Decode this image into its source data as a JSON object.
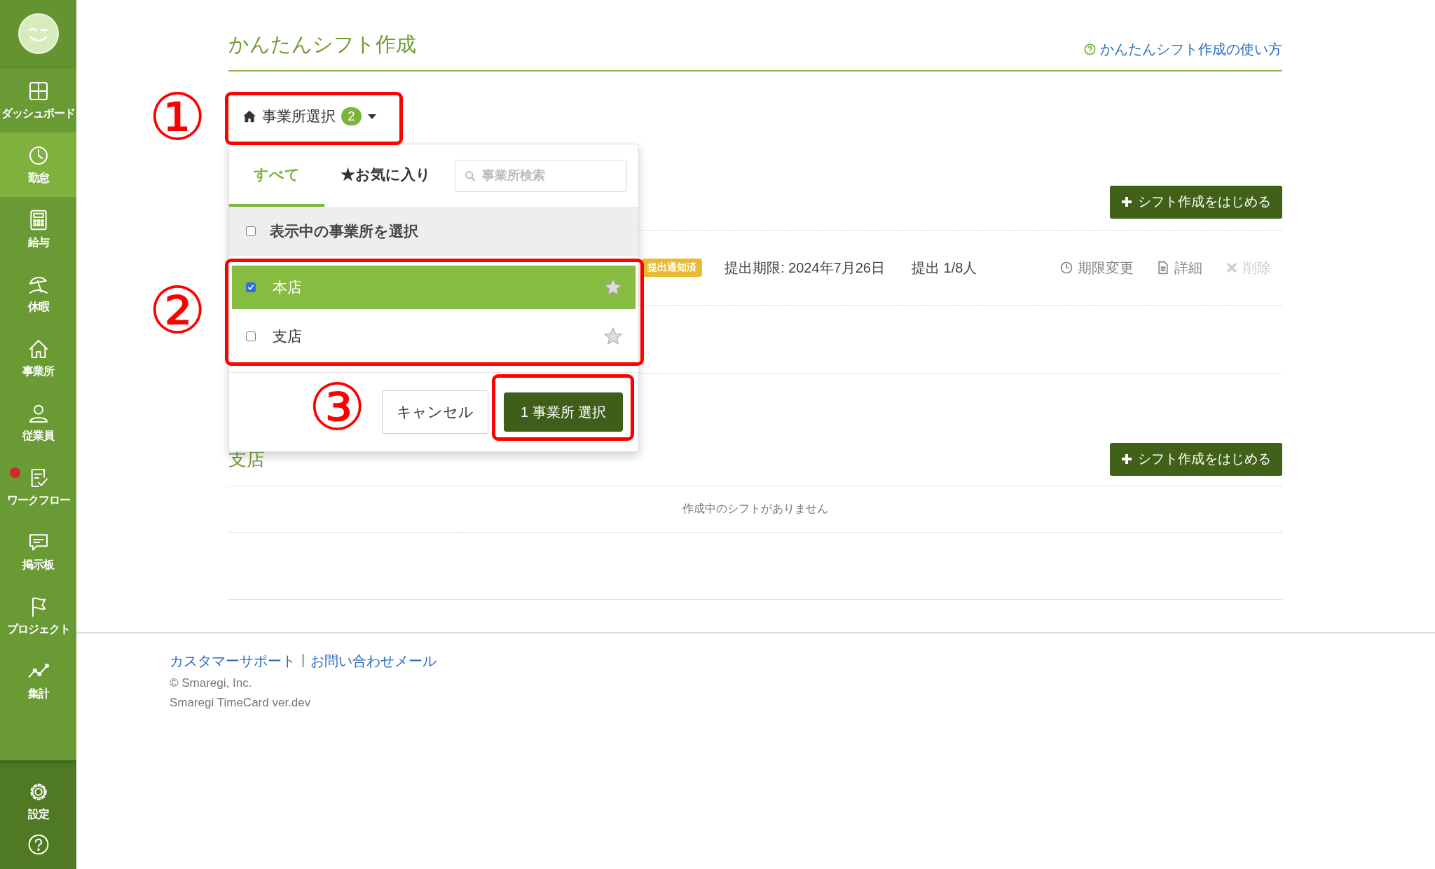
{
  "sidebar": {
    "items": [
      {
        "label": "ダッシュボード",
        "selected": false,
        "alert": false
      },
      {
        "label": "勤怠",
        "selected": true,
        "alert": false
      },
      {
        "label": "給与",
        "selected": false,
        "alert": false
      },
      {
        "label": "休暇",
        "selected": false,
        "alert": false
      },
      {
        "label": "事業所",
        "selected": false,
        "alert": false
      },
      {
        "label": "従業員",
        "selected": false,
        "alert": false
      },
      {
        "label": "ワークフロー",
        "selected": false,
        "alert": true
      },
      {
        "label": "掲示板",
        "selected": false,
        "alert": false
      },
      {
        "label": "プロジェクト",
        "selected": false,
        "alert": false
      },
      {
        "label": "集計",
        "selected": false,
        "alert": false
      }
    ],
    "bottom_items": [
      {
        "label": "設定"
      }
    ]
  },
  "page": {
    "title": "かんたんシフト作成",
    "help_link": "かんたんシフト作成の使い方"
  },
  "office_picker": {
    "label": "事業所選択",
    "count": "2",
    "expanded": true
  },
  "dropdown": {
    "tabs": [
      {
        "label": "すべて",
        "selected": true
      },
      {
        "label": "★お気に入り",
        "selected": false
      }
    ],
    "search": {
      "placeholder": "事業所検索"
    },
    "select_all": {
      "label": "表示中の事業所を選択",
      "checked": false
    },
    "offices": [
      {
        "name": "本店",
        "checked": true,
        "favorite": false
      },
      {
        "name": "支店",
        "checked": false,
        "favorite": false
      }
    ],
    "cancel_button": "キャンセル",
    "confirm_button": "1 事業所 選択"
  },
  "sections": [
    {
      "start_button": "シフト作成をはじめる",
      "shifts": [
        {
          "status": "提出通知済",
          "deadline": "提出期限: 2024年7月26日",
          "submitted": "提出 1/8人",
          "actions": [
            {
              "label": "期限変更",
              "kind": "deadline",
              "disabled": false
            },
            {
              "label": "詳細",
              "kind": "detail",
              "disabled": false
            },
            {
              "label": "削除",
              "kind": "delete",
              "disabled": true
            }
          ]
        }
      ]
    },
    {
      "name": "支店",
      "start_button": "シフト作成をはじめる",
      "empty_text": "作成中のシフトがありません"
    }
  ],
  "footer": {
    "links": [
      "カスタマーサポート",
      "お問い合わせメール"
    ],
    "separator": "|",
    "copyright": "© Smaregi, Inc.",
    "version": "Smaregi TimeCard ver.dev"
  },
  "annotations": [
    {
      "label": "①"
    },
    {
      "label": "②"
    },
    {
      "label": "③"
    }
  ]
}
